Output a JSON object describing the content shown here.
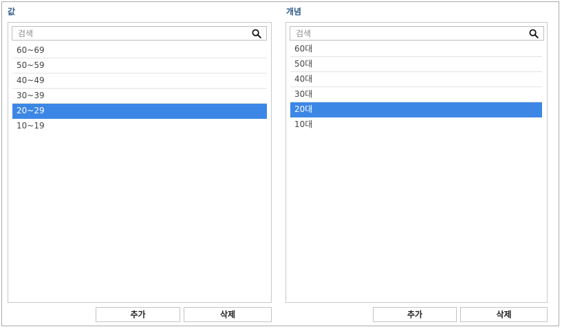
{
  "left": {
    "title": "값",
    "search": {
      "placeholder": "검색",
      "value": ""
    },
    "items": [
      {
        "label": "60~69",
        "selected": false
      },
      {
        "label": "50~59",
        "selected": false
      },
      {
        "label": "40~49",
        "selected": false
      },
      {
        "label": "30~39",
        "selected": false
      },
      {
        "label": "20~29",
        "selected": true
      },
      {
        "label": "10~19",
        "selected": false
      }
    ],
    "add_label": "추가",
    "delete_label": "삭제"
  },
  "right": {
    "title": "개념",
    "search": {
      "placeholder": "검색",
      "value": ""
    },
    "items": [
      {
        "label": "60대",
        "selected": false
      },
      {
        "label": "50대",
        "selected": false
      },
      {
        "label": "40대",
        "selected": false
      },
      {
        "label": "30대",
        "selected": false
      },
      {
        "label": "20대",
        "selected": true
      },
      {
        "label": "10대",
        "selected": false
      }
    ],
    "add_label": "추가",
    "delete_label": "삭제"
  },
  "colors": {
    "selected_bg": "#3c87e6",
    "title": "#2f5c8a"
  },
  "icons": {
    "search": "search-icon"
  }
}
